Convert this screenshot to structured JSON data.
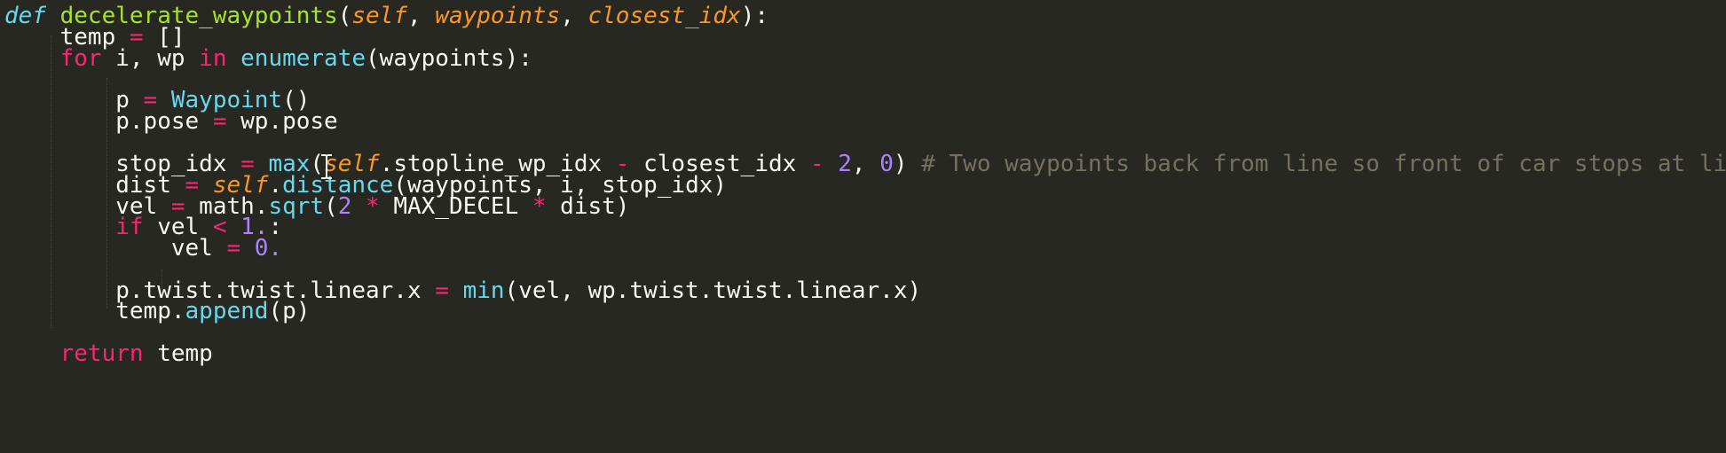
{
  "code": {
    "l1": {
      "kw_def": "def",
      "fn_name": "decelerate_waypoints",
      "open": "(",
      "p1": "self",
      "sep1": ", ",
      "p2": "waypoints",
      "sep2": ", ",
      "p3": "closest_idx",
      "close": "):"
    },
    "l2": {
      "indent": "    ",
      "lhs": "temp ",
      "op": "=",
      "rhs": " []"
    },
    "l3": {
      "indent": "    ",
      "kw_for": "for",
      "mid1": " i, wp ",
      "kw_in": "in",
      "sp": " ",
      "builtin": "enumerate",
      "rest": "(waypoints):"
    },
    "l5": {
      "indent": "        ",
      "lhs": "p ",
      "op": "=",
      "sp": " ",
      "builtin": "Waypoint",
      "rest": "()"
    },
    "l6": {
      "indent": "        ",
      "lhs": "p.pose ",
      "op": "=",
      "rhs": " wp.pose"
    },
    "l8": {
      "indent": "        ",
      "lhs": "stop_idx ",
      "op1": "=",
      "sp1": " ",
      "builtin": "max",
      "open": "(",
      "self": "self",
      "mid": ".stopline_wp_idx ",
      "op2": "-",
      "mid2": " closest_idx ",
      "op3": "-",
      "sp2": " ",
      "n1": "2",
      "sep": ", ",
      "n2": "0",
      "close": ") ",
      "comment": "# Two waypoints back from line so front of car stops at lin"
    },
    "l9": {
      "indent": "        ",
      "lhs": "dist ",
      "op": "=",
      "sp": " ",
      "self": "self",
      "dot": ".",
      "builtin": "distance",
      "rest": "(waypoints, i, stop_idx)"
    },
    "l10": {
      "indent": "        ",
      "lhs": "vel ",
      "op1": "=",
      "mid": " math.",
      "builtin": "sqrt",
      "open": "(",
      "n1": "2",
      "sp1": " ",
      "op2": "*",
      "mid2": " MAX_DECEL ",
      "op3": "*",
      "rest": " dist)"
    },
    "l11": {
      "indent": "        ",
      "kw_if": "if",
      "mid": " vel ",
      "op": "<",
      "sp": " ",
      "num": "1.",
      "rest": ":"
    },
    "l12": {
      "indent": "            ",
      "lhs": "vel ",
      "op": "=",
      "sp": " ",
      "num": "0."
    },
    "l14": {
      "indent": "        ",
      "lhs": "p.twist.twist.linear.x ",
      "op": "=",
      "sp": " ",
      "builtin": "min",
      "rest": "(vel, wp.twist.twist.linear.x)"
    },
    "l15": {
      "indent": "        ",
      "lhs": "temp.",
      "builtin": "append",
      "rest": "(p)"
    },
    "l17": {
      "indent": "    ",
      "kw_return": "return",
      "rest": " temp"
    }
  },
  "colors": {
    "background": "#272822",
    "foreground": "#f8f8f2",
    "keyword": "#f92672",
    "function_name": "#a6e22e",
    "builtin": "#66d9ef",
    "parameter": "#fd971f",
    "number": "#ae81ff",
    "comment": "#75715e"
  },
  "icons": {
    "text_cursor": "i-beam-cursor-icon"
  }
}
